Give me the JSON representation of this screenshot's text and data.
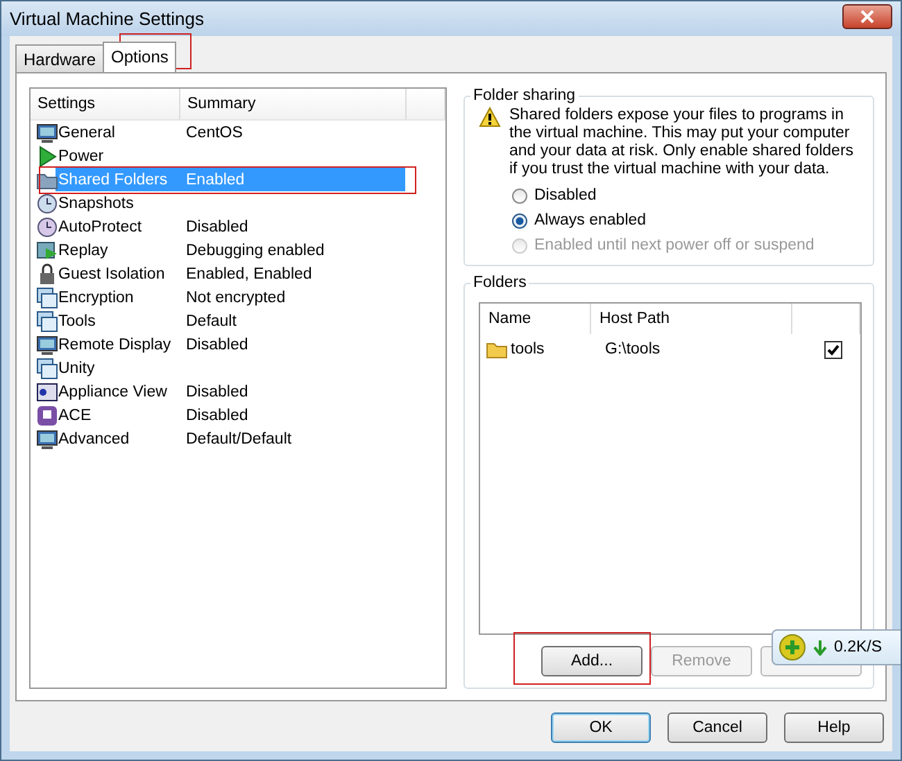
{
  "window": {
    "title": "Virtual Machine Settings"
  },
  "tabs": [
    {
      "label": "Hardware",
      "selected": false,
      "highlighted": false
    },
    {
      "label": "Options",
      "selected": true,
      "highlighted": true
    }
  ],
  "settings": {
    "columns": [
      "Settings",
      "Summary"
    ],
    "rows": [
      {
        "name": "General",
        "summary": "CentOS",
        "selected": false,
        "highlighted": false
      },
      {
        "name": "Power",
        "selected": false,
        "highlighted": false
      },
      {
        "name": "Shared Folders",
        "summary": "Enabled",
        "selected": true,
        "highlighted": true
      },
      {
        "name": "Snapshots",
        "selected": false,
        "highlighted": false
      },
      {
        "name": "AutoProtect",
        "summary": "Disabled",
        "selected": false,
        "highlighted": false
      },
      {
        "name": "Replay",
        "summary": "Debugging enabled",
        "selected": false,
        "highlighted": false
      },
      {
        "name": "Guest Isolation",
        "summary": "Enabled, Enabled",
        "selected": false,
        "highlighted": false
      },
      {
        "name": "Encryption",
        "summary": "Not encrypted",
        "selected": false,
        "highlighted": false
      },
      {
        "name": "Tools",
        "summary": "Default",
        "selected": false,
        "highlighted": false
      },
      {
        "name": "Remote Display",
        "summary": "Disabled",
        "selected": false,
        "highlighted": false
      },
      {
        "name": "Unity",
        "selected": false,
        "highlighted": false
      },
      {
        "name": "Appliance View",
        "summary": "Disabled",
        "selected": false,
        "highlighted": false
      },
      {
        "name": "ACE",
        "summary": "Disabled",
        "selected": false,
        "highlighted": false
      },
      {
        "name": "Advanced",
        "summary": "Default/Default",
        "selected": false,
        "highlighted": false
      }
    ]
  },
  "folder_sharing": {
    "title": "Folder sharing",
    "warning": "Shared folders expose your files to programs in the virtual machine. This may put your computer and your data at risk. Only enable shared folders if you trust the virtual machine with your data.",
    "options": [
      {
        "label": "Disabled",
        "selected": false,
        "disabled": false
      },
      {
        "label": "Always enabled",
        "selected": true,
        "disabled": false
      },
      {
        "label": "Enabled until next power off or suspend",
        "selected": false,
        "disabled": true
      }
    ]
  },
  "folders": {
    "title": "Folders",
    "columns": [
      "Name",
      "Host Path"
    ],
    "rows": [
      {
        "name": "tools",
        "host_path": "G:\\tools",
        "checked": true
      }
    ],
    "buttons": [
      {
        "label": "Add...",
        "disabled": false,
        "highlighted": true
      },
      {
        "label": "Remove",
        "disabled": true,
        "highlighted": false
      },
      {
        "disabled": true,
        "highlighted": false
      }
    ]
  },
  "speed_widget": {
    "download": "0.2K/S"
  },
  "buttons": [
    {
      "label": "OK",
      "default": true
    },
    {
      "label": "Cancel",
      "default": false
    },
    {
      "label": "Help",
      "default": false
    }
  ]
}
